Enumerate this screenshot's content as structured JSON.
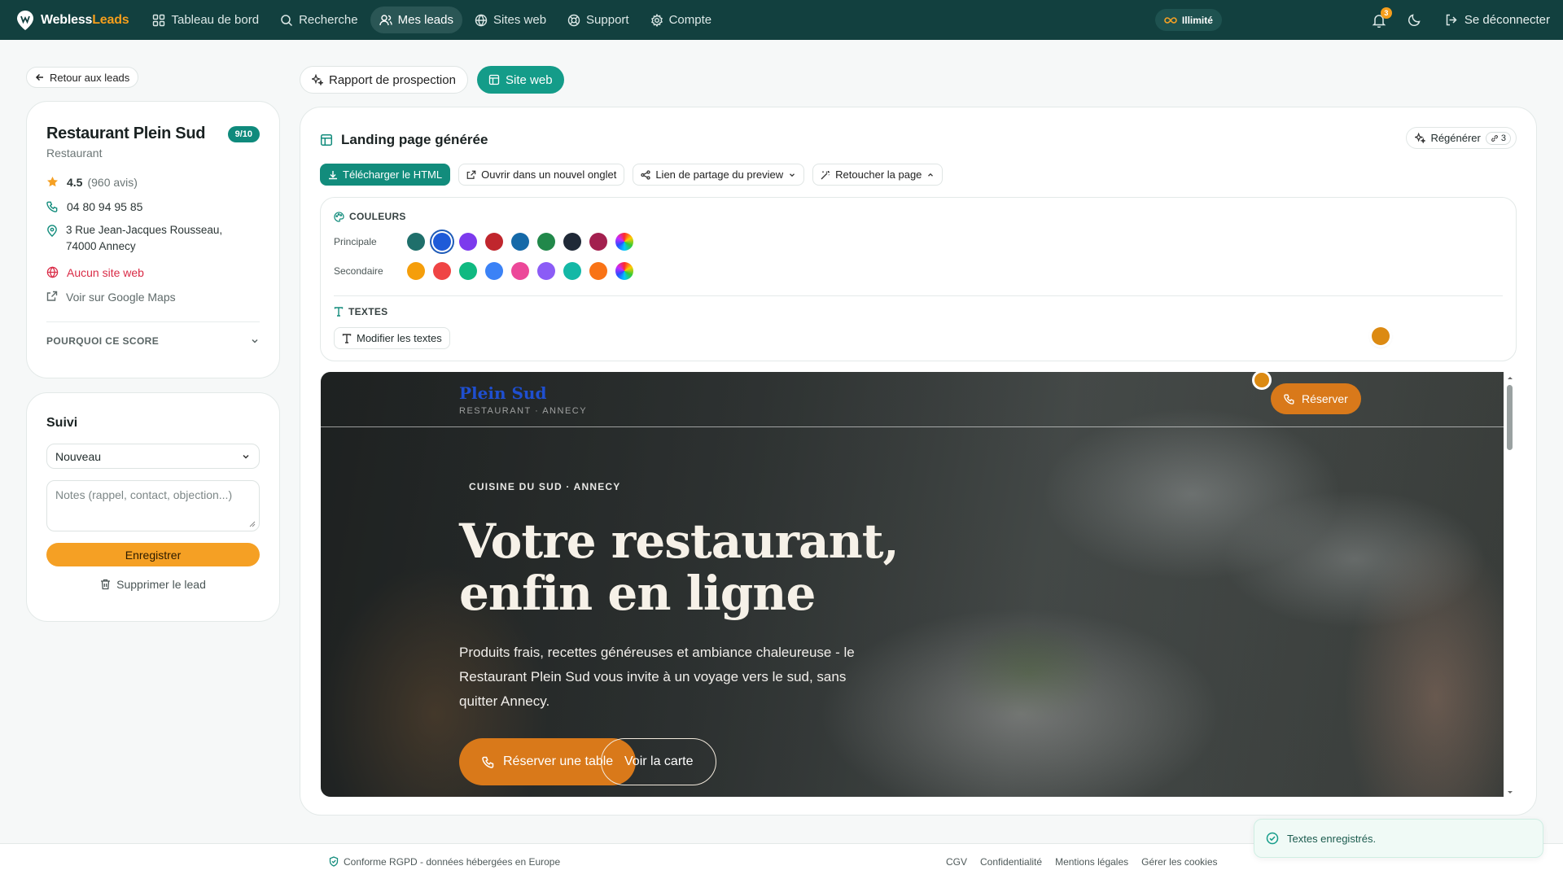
{
  "brand": {
    "name_part1": "Webless",
    "name_part2": "Leads"
  },
  "nav": {
    "items": [
      {
        "label": "Tableau de bord",
        "icon": "dashboard-icon"
      },
      {
        "label": "Recherche",
        "icon": "search-icon"
      },
      {
        "label": "Mes leads",
        "icon": "users-icon",
        "active": true
      },
      {
        "label": "Sites web",
        "icon": "globe-icon"
      },
      {
        "label": "Support",
        "icon": "support-icon"
      },
      {
        "label": "Compte",
        "icon": "gear-icon"
      }
    ],
    "plan_label": "Illimité",
    "notification_count": "3",
    "logout_label": "Se déconnecter"
  },
  "back_label": "Retour aux leads",
  "lead": {
    "name": "Restaurant Plein Sud",
    "score": "9/10",
    "category": "Restaurant",
    "rating": "4.5",
    "reviews": "(960 avis)",
    "phone": "04 80 94 95 85",
    "address_line1": "3 Rue Jean-Jacques Rousseau,",
    "address_line2": "74000 Annecy",
    "website_status": "Aucun site web",
    "maps_link": "Voir sur Google Maps",
    "why_score": "POURQUOI CE SCORE"
  },
  "suivi": {
    "title": "Suivi",
    "status": "Nouveau",
    "notes_placeholder": "Notes (rappel, contact, objection...)",
    "save_label": "Enregistrer",
    "delete_label": "Supprimer le lead"
  },
  "tabs": {
    "report": "Rapport de prospection",
    "site": "Site web"
  },
  "landing": {
    "title": "Landing page générée",
    "regen_label": "Régénérer",
    "regen_count": "3",
    "actions": {
      "download": "Télécharger le HTML",
      "open_tab": "Ouvrir dans un nouvel onglet",
      "share": "Lien de partage du preview",
      "retouch": "Retoucher la page"
    },
    "colors_title": "COULEURS",
    "primary_label": "Principale",
    "secondary_label": "Secondaire",
    "primary_colors": [
      "#1f6f6b",
      "#1e5bd8",
      "#7c3aed",
      "#c0262d",
      "#1569a8",
      "#21884a",
      "#1f2937",
      "#a3204f",
      "rainbow"
    ],
    "secondary_colors": [
      "#f59e0b",
      "#ef4444",
      "#10b981",
      "#3b82f6",
      "#ec4899",
      "#8b5cf6",
      "#14b8a6",
      "#f97316",
      "rainbow"
    ],
    "selected_primary_index": 1,
    "texts_title": "TEXTES",
    "edit_texts_label": "Modifier les textes"
  },
  "preview": {
    "logo": "Plein Sud",
    "logo_sub": "RESTAURANT · ANNECY",
    "reserve": "Réserver",
    "kicker": "CUISINE DU SUD · ANNECY",
    "headline_line1": "Votre restaurant,",
    "headline_line2": "enfin en ligne",
    "paragraph": "Produits frais, recettes généreuses et ambiance chaleureuse - le Restaurant Plein Sud vous invite à un voyage vers le sud, sans quitter Annecy.",
    "cta_primary": "Réserver une table",
    "cta_secondary": "Voir la carte"
  },
  "footer": {
    "rgpd": "Conforme RGPD - données hébergées en Europe",
    "links": [
      "CGV",
      "Confidentialité",
      "Mentions légales",
      "Gérer les cookies"
    ]
  },
  "toast": {
    "message": "Textes enregistrés."
  },
  "colors": {
    "nav_bg": "#12403f",
    "accent": "#149c89",
    "orange": "#f5a024",
    "danger": "#d92b46"
  }
}
